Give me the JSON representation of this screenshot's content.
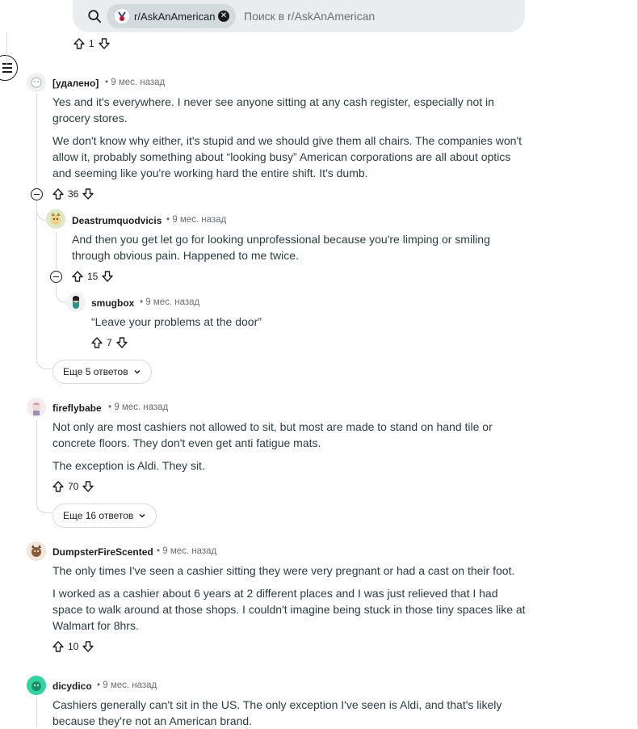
{
  "search": {
    "subreddit": "r/AskAnAmerican",
    "placeholder": "Поиск в r/AskAnAmerican"
  },
  "top_vote": {
    "count": "1"
  },
  "comments": [
    {
      "author": "[удалено]",
      "time": "9 мес. назад",
      "paragraphs": [
        "Yes and it's everywhere. I never see anyone sitting at any cash register, especially not in grocery stores.",
        "We don't know why either, it's stupid and we should give them all chairs. The companies won't allow it, probably something about “looking busy” American corporations are all about optics and seeming like you're working hard the entire shift. It's dumb."
      ],
      "votes": "36"
    },
    {
      "author": "Deastrumquodvicis",
      "time": "9 мес. назад",
      "paragraphs": [
        "And then you get let go for looking unprofessional because you're limping or smiling through obvious pain. Happened to me twice."
      ],
      "votes": "15"
    },
    {
      "author": "smugbox",
      "time": "9 мес. назад",
      "paragraphs": [
        "“Leave your problems at the door”"
      ],
      "votes": "7"
    },
    {
      "author": "fireflybabe",
      "time": "9 мес. назад",
      "paragraphs": [
        "Not only are most cashiers not allowed to sit, but most are made to stand on hand tile or concrete floors. They don't even get anti fatigue mats.",
        "The exception is Aldi. They sit."
      ],
      "votes": "70"
    },
    {
      "author": "DumpsterFireScented",
      "time": "9 мес. назад",
      "paragraphs": [
        "The only times I've seen a cashier sitting they were very pregnant or had a cast on their foot.",
        "I worked as a cashier about 6 years at 2 different places and I was just relieved that I had space to walk around at those shops. I couldn't imagine being stuck in those tiny spaces like at Walmart for 8hrs."
      ],
      "votes": "10"
    },
    {
      "author": "dicydico",
      "time": "9 мес. назад",
      "paragraphs": [
        "Cashiers generally can't sit in the US. The only exception I've seen is Aldi, and that's likely because they're not an American brand."
      ]
    }
  ],
  "more_replies": [
    {
      "label": "Еще 5 ответов"
    },
    {
      "label": "Еще 16 ответов"
    }
  ],
  "separator": "•"
}
